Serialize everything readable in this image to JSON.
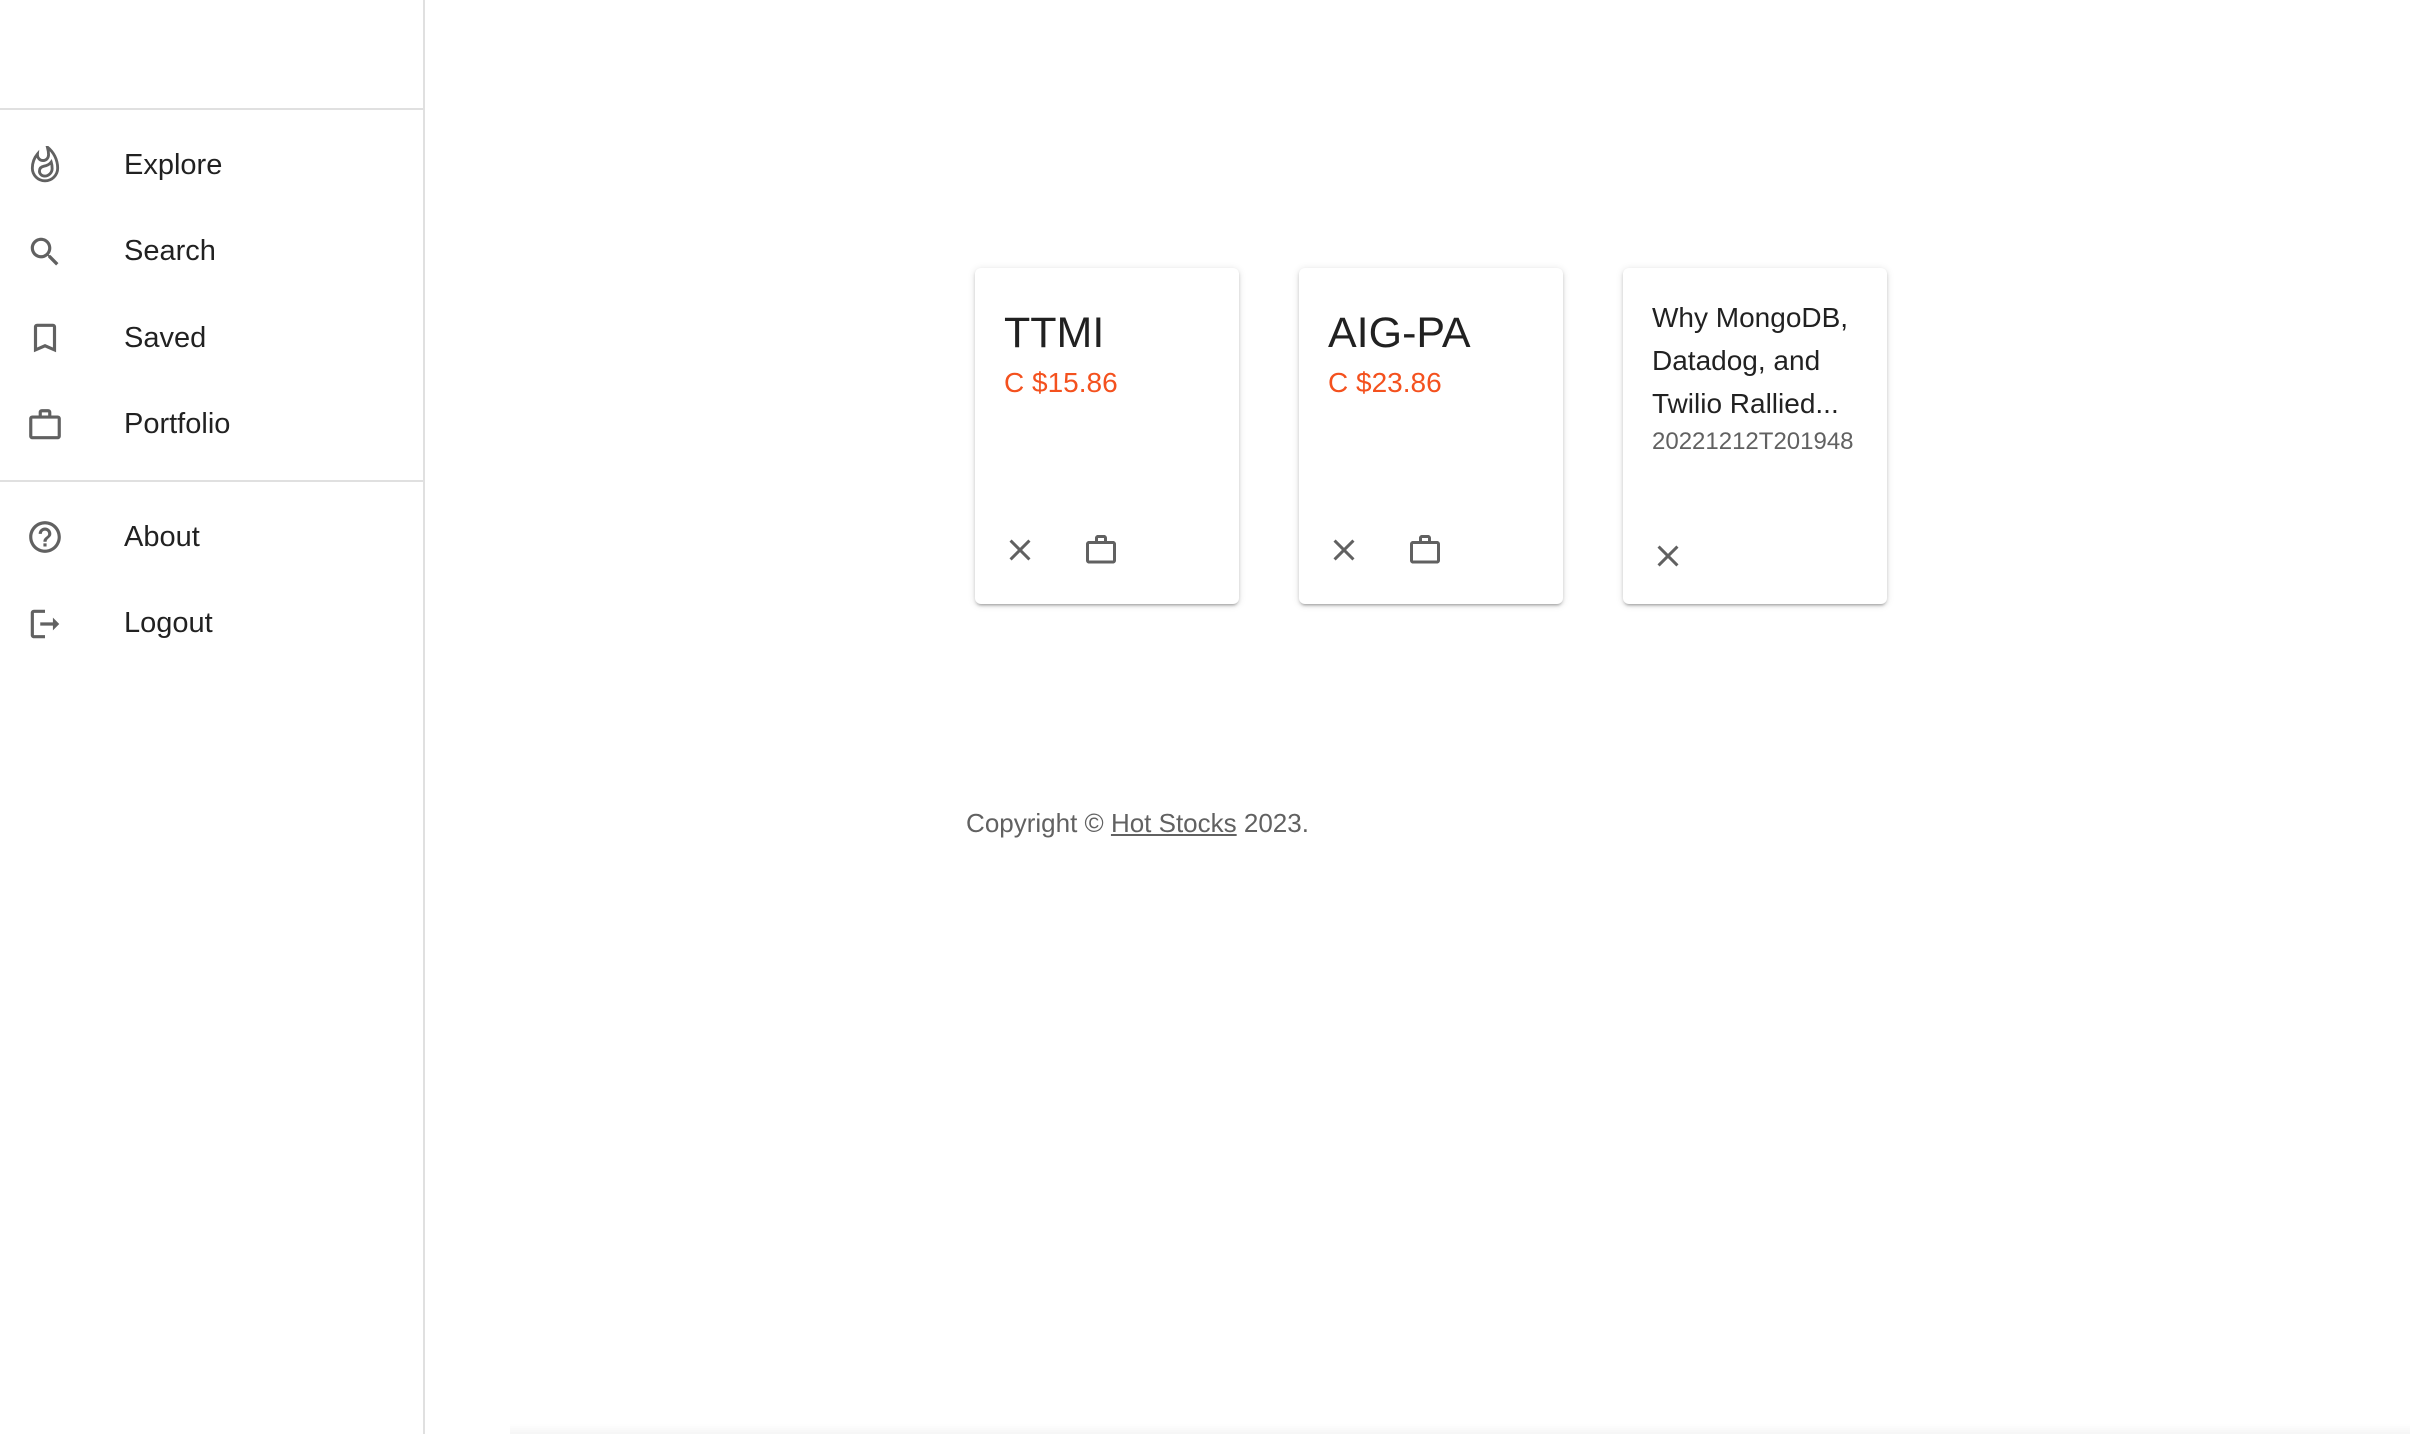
{
  "sidebar": {
    "primary_items": [
      {
        "label": "Explore",
        "icon": "whatshot-icon"
      },
      {
        "label": "Search",
        "icon": "search-icon"
      },
      {
        "label": "Saved",
        "icon": "bookmark-icon"
      },
      {
        "label": "Portfolio",
        "icon": "briefcase-icon"
      }
    ],
    "secondary_items": [
      {
        "label": "About",
        "icon": "help-circle-icon"
      },
      {
        "label": "Logout",
        "icon": "logout-icon"
      }
    ]
  },
  "cards": [
    {
      "type": "stock",
      "ticker": "TTMI",
      "price": "C $15.86"
    },
    {
      "type": "stock",
      "ticker": "AIG-PA",
      "price": "C $23.86"
    },
    {
      "type": "news",
      "title": "Why MongoDB, Datadog, and Twilio Rallied...",
      "date": "20221212T201948"
    }
  ],
  "footer": {
    "prefix": "Copyright © ",
    "link": "Hot Stocks",
    "suffix": " 2023."
  },
  "colors": {
    "price_down": "#f4511e",
    "icon": "#616161",
    "divider": "#e0e0e0"
  }
}
